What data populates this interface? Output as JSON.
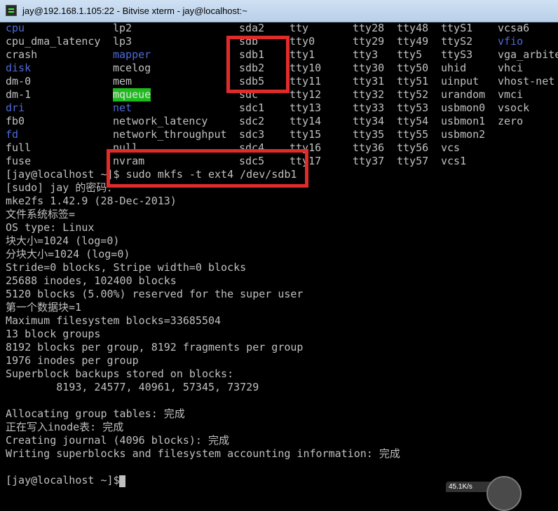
{
  "window": {
    "title": "jay@192.168.1.105:22 - Bitvise xterm - jay@localhost:~"
  },
  "listing": {
    "rows": [
      [
        {
          "t": "cpu",
          "c": "dir"
        },
        {
          "t": "lp2"
        },
        {
          "t": "sda2"
        },
        {
          "t": "tty"
        },
        {
          "t": "tty28"
        },
        {
          "t": "tty48"
        },
        {
          "t": "ttyS1"
        },
        {
          "t": "vcsa6"
        }
      ],
      [
        {
          "t": "cpu_dma_latency"
        },
        {
          "t": "lp3"
        },
        {
          "t": "sdb"
        },
        {
          "t": "tty0"
        },
        {
          "t": "tty29"
        },
        {
          "t": "tty49"
        },
        {
          "t": "ttyS2"
        },
        {
          "t": "vfio",
          "c": "dir"
        }
      ],
      [
        {
          "t": "crash"
        },
        {
          "t": "mapper",
          "c": "dir"
        },
        {
          "t": "sdb1"
        },
        {
          "t": "tty1"
        },
        {
          "t": "tty3"
        },
        {
          "t": "tty5"
        },
        {
          "t": "ttyS3"
        },
        {
          "t": "vga_arbiter"
        }
      ],
      [
        {
          "t": "disk",
          "c": "dir"
        },
        {
          "t": "mcelog"
        },
        {
          "t": "sdb2"
        },
        {
          "t": "tty10"
        },
        {
          "t": "tty30"
        },
        {
          "t": "tty50"
        },
        {
          "t": "uhid"
        },
        {
          "t": "vhci"
        }
      ],
      [
        {
          "t": "dm-0"
        },
        {
          "t": "mem"
        },
        {
          "t": "sdb5"
        },
        {
          "t": "tty11"
        },
        {
          "t": "tty31"
        },
        {
          "t": "tty51"
        },
        {
          "t": "uinput"
        },
        {
          "t": "vhost-net"
        }
      ],
      [
        {
          "t": "dm-1"
        },
        {
          "t": "mqueue",
          "c": "green"
        },
        {
          "t": "sdc"
        },
        {
          "t": "tty12"
        },
        {
          "t": "tty32"
        },
        {
          "t": "tty52"
        },
        {
          "t": "urandom"
        },
        {
          "t": "vmci"
        }
      ],
      [
        {
          "t": "dri",
          "c": "dir"
        },
        {
          "t": "net",
          "c": "dir"
        },
        {
          "t": "sdc1"
        },
        {
          "t": "tty13"
        },
        {
          "t": "tty33"
        },
        {
          "t": "tty53"
        },
        {
          "t": "usbmon0"
        },
        {
          "t": "vsock"
        }
      ],
      [
        {
          "t": "fb0"
        },
        {
          "t": "network_latency"
        },
        {
          "t": "sdc2"
        },
        {
          "t": "tty14"
        },
        {
          "t": "tty34"
        },
        {
          "t": "tty54"
        },
        {
          "t": "usbmon1"
        },
        {
          "t": "zero"
        }
      ],
      [
        {
          "t": "fd",
          "c": "dir"
        },
        {
          "t": "network_throughput"
        },
        {
          "t": "sdc3"
        },
        {
          "t": "tty15"
        },
        {
          "t": "tty35"
        },
        {
          "t": "tty55"
        },
        {
          "t": "usbmon2"
        },
        {
          "t": ""
        }
      ],
      [
        {
          "t": "full"
        },
        {
          "t": "null"
        },
        {
          "t": "sdc4"
        },
        {
          "t": "tty16"
        },
        {
          "t": "tty36"
        },
        {
          "t": "tty56"
        },
        {
          "t": "vcs"
        },
        {
          "t": ""
        }
      ],
      [
        {
          "t": "fuse"
        },
        {
          "t": "nvram"
        },
        {
          "t": "sdc5"
        },
        {
          "t": "tty17"
        },
        {
          "t": "tty37"
        },
        {
          "t": "tty57"
        },
        {
          "t": "vcs1"
        },
        {
          "t": ""
        }
      ]
    ]
  },
  "output": [
    "[jay@localhost ~]$ sudo mkfs -t ext4 /dev/sdb1",
    "[sudo] jay 的密码：",
    "mke2fs 1.42.9 (28-Dec-2013)",
    "文件系统标签=",
    "OS type: Linux",
    "块大小=1024 (log=0)",
    "分块大小=1024 (log=0)",
    "Stride=0 blocks, Stripe width=0 blocks",
    "25688 inodes, 102400 blocks",
    "5120 blocks (5.00%) reserved for the super user",
    "第一个数据块=1",
    "Maximum filesystem blocks=33685504",
    "13 block groups",
    "8192 blocks per group, 8192 fragments per group",
    "1976 inodes per group",
    "Superblock backups stored on blocks:",
    "        8193, 24577, 40961, 57345, 73729",
    "",
    "Allocating group tables: 完成",
    "正在写入inode表: 完成",
    "Creating journal (4096 blocks): 完成",
    "Writing superblocks and filesystem accounting information: 完成",
    "",
    "[jay@localhost ~]$"
  ],
  "network_widget": {
    "speed": "45.1K/s"
  },
  "colors": {
    "directory": "#4f6bd8",
    "text": "#c0c0c0",
    "highlight": "#e02b2b",
    "green_bg": "#1dbb1d"
  }
}
